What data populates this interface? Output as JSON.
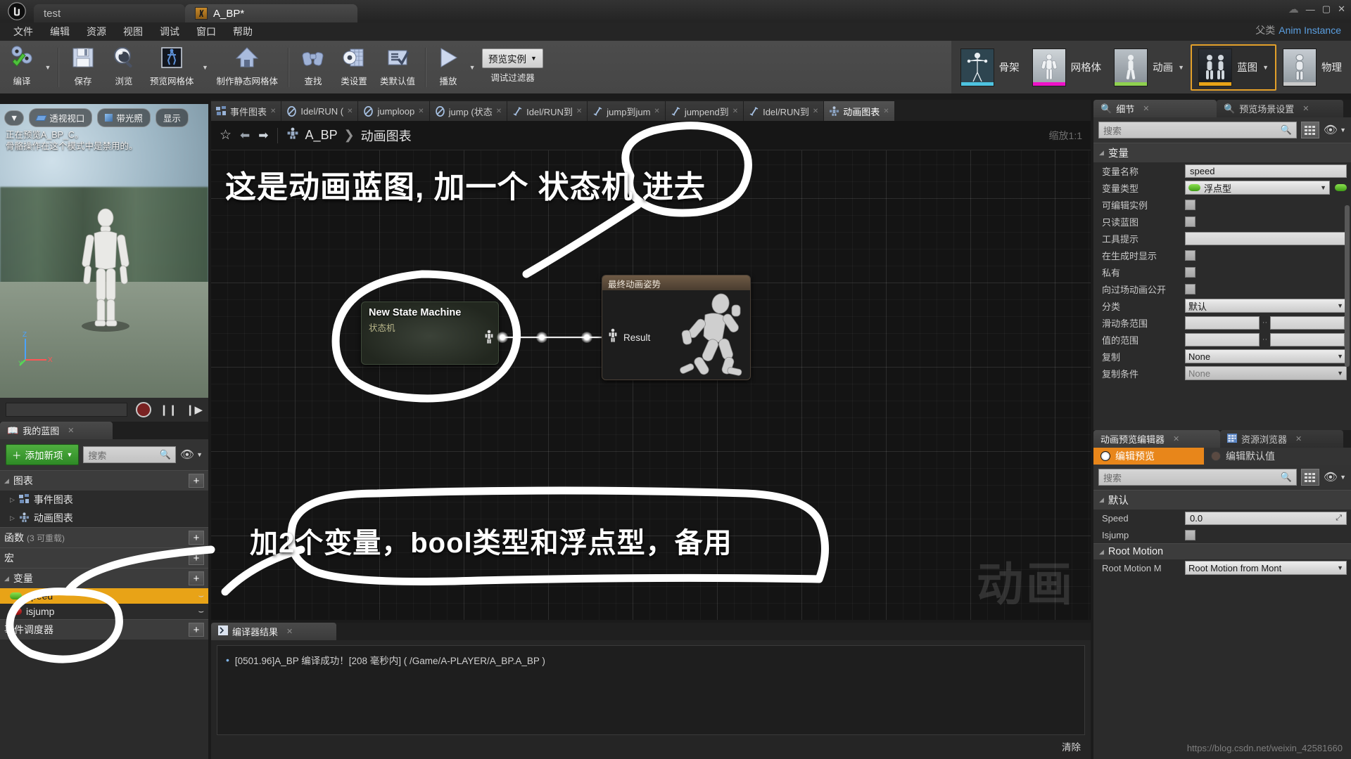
{
  "window": {
    "app_icon": "unreal-logo-icon",
    "tabs": [
      {
        "label": "test",
        "active": false,
        "icon": "none"
      },
      {
        "label": "A_BP*",
        "active": true,
        "icon": "blueprint-thumb-icon"
      }
    ],
    "controls": {
      "cloud": "cloud-icon",
      "minimize": "—",
      "maximize": "▢",
      "close": "✕"
    }
  },
  "menu": {
    "items": [
      "文件",
      "编辑",
      "资源",
      "视图",
      "调试",
      "窗口",
      "帮助"
    ],
    "parent_label": "父类",
    "parent_value": "Anim Instance"
  },
  "toolbar": {
    "buttons": [
      {
        "label": "编译",
        "icon": "compile-gears-check-icon",
        "caret": true
      },
      {
        "label": "保存",
        "icon": "save-floppy-icon",
        "caret": false
      },
      {
        "label": "浏览",
        "icon": "browse-magnifier-icon",
        "caret": false
      },
      {
        "label": "预览网格体",
        "icon": "preview-mesh-icon",
        "caret": true
      },
      {
        "label": "制作静态网格体",
        "icon": "make-static-mesh-house-icon",
        "caret": false
      },
      {
        "label": "查找",
        "icon": "find-binoculars-icon",
        "caret": false
      },
      {
        "label": "类设置",
        "icon": "class-settings-gear-icon",
        "caret": false
      },
      {
        "label": "类默认值",
        "icon": "class-defaults-checklist-icon",
        "caret": false
      },
      {
        "label": "播放",
        "icon": "play-triangle-icon",
        "caret": true
      }
    ],
    "debug_filter_label": "调试过滤器",
    "debug_filter_value": "预览实例"
  },
  "modes": [
    {
      "label": "骨架",
      "selected": false,
      "accent": "#4ec3e0",
      "thumb": "skeleton-thumb"
    },
    {
      "label": "网格体",
      "selected": false,
      "accent": "#ee12c8",
      "thumb": "mesh-thumb"
    },
    {
      "label": "动画",
      "selected": false,
      "accent": "#8fd14f",
      "thumb": "animation-thumb",
      "caret": true
    },
    {
      "label": "蓝图",
      "selected": true,
      "accent": "#e8a317",
      "thumb": "blueprint-thumb",
      "caret": true
    },
    {
      "label": "物理",
      "selected": false,
      "accent": "#c9c9c9",
      "thumb": "physics-thumb"
    }
  ],
  "viewport": {
    "dropdown_icon": "chevron-down-icon",
    "pills": [
      {
        "label": "透视视口",
        "icon": "perspective-icon"
      },
      {
        "label": "带光照",
        "icon": "lit-cube-icon"
      },
      {
        "label": "显示",
        "icon": "none"
      }
    ],
    "notes": [
      "正在预览A_BP_C。",
      "骨骼操作在这个模式中是禁用的。"
    ],
    "axis_labels": [
      "Z",
      "Y",
      "X"
    ],
    "transport": [
      "record-icon",
      "pause-icon",
      "step-icon"
    ]
  },
  "my_blueprint": {
    "tab_label": "我的蓝图",
    "tab_icon": "book-icon",
    "add_button": "添加新项",
    "search_placeholder": "搜索",
    "sections": [
      {
        "title": "图表",
        "plus": "+",
        "items": [
          {
            "label": "事件图表",
            "icon": "event-graph-icon",
            "expandable": true
          },
          {
            "label": "动画图表",
            "icon": "anim-graph-icon",
            "expandable": true
          }
        ]
      },
      {
        "title": "函数",
        "suffix": "(3 可重载)",
        "plus": "+",
        "items": []
      },
      {
        "title": "宏",
        "plus": "+",
        "items": []
      },
      {
        "title": "变量",
        "plus": "+",
        "items": [
          {
            "label": "speed",
            "dot_color": "#5ec92b",
            "selected": true
          },
          {
            "label": "isjump",
            "dot_color": "#b01111",
            "selected": false
          }
        ]
      },
      {
        "title": "事件调度器",
        "plus": "+",
        "items": []
      }
    ]
  },
  "graph": {
    "tabs": [
      {
        "label": "事件图表",
        "icon": "event-graph-icon",
        "active": false
      },
      {
        "label": "Idel/RUN (",
        "icon": "state-icon",
        "active": false
      },
      {
        "label": "jumploop",
        "icon": "state-icon",
        "active": false
      },
      {
        "label": "jump (状态",
        "icon": "state-icon",
        "active": false
      },
      {
        "label": "Idel/RUN到",
        "icon": "transition-icon",
        "active": false
      },
      {
        "label": "jump到jum",
        "icon": "transition-icon",
        "active": false
      },
      {
        "label": "jumpend到",
        "icon": "transition-icon",
        "active": false
      },
      {
        "label": "Idel/RUN到",
        "icon": "transition-icon",
        "active": false
      },
      {
        "label": "动画图表",
        "icon": "anim-graph-icon",
        "active": true
      }
    ],
    "breadcrumb": [
      "A_BP",
      "动画图表"
    ],
    "breadcrumb_sep": "❯",
    "zoom_label": "缩放1:1",
    "nav_icons": [
      "star-icon",
      "back-arrow-icon",
      "forward-arrow-icon",
      "blueprint-icon"
    ],
    "watermark": "动画",
    "nodes": [
      {
        "title": "New State Machine",
        "subtitle": "状态机",
        "type": "state-machine"
      },
      {
        "title": "最终动画姿势",
        "pin_label": "Result",
        "type": "output-pose"
      }
    ]
  },
  "annotations": [
    {
      "text": "这是动画蓝图, 加一个 状态机 进去",
      "id": "ann1"
    },
    {
      "text": "加2个变量，bool类型和浮点型，备用",
      "id": "ann2"
    }
  ],
  "compiler": {
    "tab_label": "编译器结果",
    "tab_icon": "compiler-icon",
    "message": "[0501.96]A_BP 编译成功！[208 毫秒内] ( /Game/A-PLAYER/A_BP.A_BP )",
    "clear_label": "清除"
  },
  "details": {
    "tabs": [
      {
        "label": "细节",
        "icon": "details-icon",
        "active": true
      },
      {
        "label": "预览场景设置",
        "icon": "preview-scene-icon",
        "active": false
      }
    ],
    "search_placeholder": "搜索",
    "category": "变量",
    "rows": [
      {
        "label": "变量名称",
        "type": "text",
        "value": "speed"
      },
      {
        "label": "变量类型",
        "type": "dropdown-pin",
        "value": "浮点型",
        "pin_color": "#5ec92b"
      },
      {
        "label": "可编辑实例",
        "type": "checkbox",
        "checked": false
      },
      {
        "label": "只读蓝图",
        "type": "checkbox",
        "checked": false
      },
      {
        "label": "工具提示",
        "type": "text",
        "value": ""
      },
      {
        "label": "在生成时显示",
        "type": "checkbox",
        "checked": false
      },
      {
        "label": "私有",
        "type": "checkbox",
        "checked": false
      },
      {
        "label": "向过场动画公开",
        "type": "checkbox",
        "checked": false
      },
      {
        "label": "分类",
        "type": "dropdown",
        "value": "默认"
      },
      {
        "label": "滑动条范围",
        "type": "range",
        "value": [
          "",
          ""
        ]
      },
      {
        "label": "值的范围",
        "type": "range",
        "value": [
          "",
          ""
        ]
      },
      {
        "label": "复制",
        "type": "dropdown",
        "value": "None"
      },
      {
        "label": "复制条件",
        "type": "dropdown",
        "value": "None",
        "disabled": true
      }
    ]
  },
  "anim_preview": {
    "tabs": [
      {
        "label": "动画预览编辑器",
        "icon": "none",
        "active": true
      },
      {
        "label": "资源浏览器",
        "icon": "asset-browser-icon",
        "active": false
      }
    ],
    "toggles": [
      {
        "label": "编辑预览",
        "on": true
      },
      {
        "label": "编辑默认值",
        "on": false
      }
    ],
    "search_placeholder": "搜索",
    "sections": [
      {
        "title": "默认",
        "rows": [
          {
            "label": "Speed",
            "type": "text",
            "value": "0.0"
          },
          {
            "label": "Isjump",
            "type": "checkbox",
            "checked": false
          }
        ]
      },
      {
        "title": "Root Motion",
        "rows": [
          {
            "label": "Root Motion M",
            "type": "dropdown",
            "value": "Root Motion from Mont"
          }
        ]
      }
    ]
  },
  "footer": {
    "url": "https://blog.csdn.net/weixin_42581660"
  }
}
